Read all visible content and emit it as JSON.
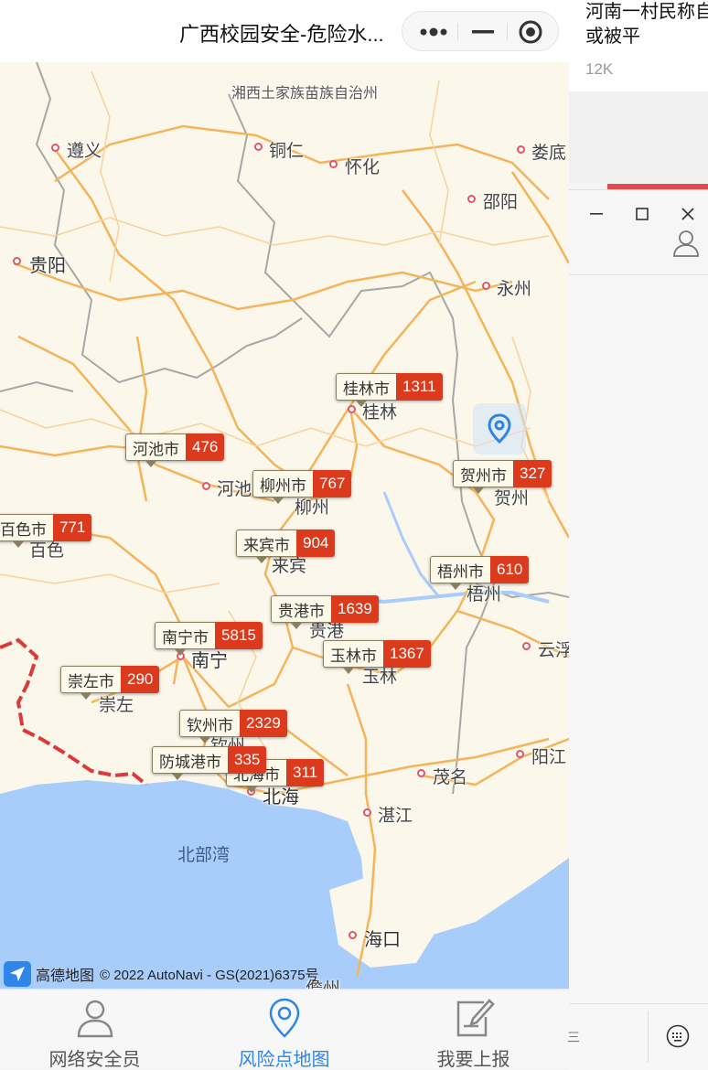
{
  "app": {
    "title": "广西校园安全-危险水...",
    "capsule": {
      "more_icon": "more-dots-icon",
      "minimize_icon": "minimize-icon",
      "close_icon": "record-circle-icon"
    }
  },
  "map": {
    "region_labels": [
      "湘西土家族苗族自治州"
    ],
    "places": [
      "遵义",
      "铜仁",
      "怀化",
      "娄底",
      "邵阳",
      "贵阳",
      "永州",
      "桂林",
      "河池",
      "柳州",
      "百色",
      "来宾",
      "梧州",
      "贺州",
      "贵港",
      "南宁",
      "玉林",
      "云浮",
      "崇左",
      "钦州",
      "北海",
      "茂名",
      "阳江",
      "湛江",
      "海口",
      "儋州"
    ],
    "sea_label": "北部湾",
    "markers": [
      {
        "name": "桂林市",
        "count": "1311"
      },
      {
        "name": "河池市",
        "count": "476"
      },
      {
        "name": "柳州市",
        "count": "767"
      },
      {
        "name": "贺州市",
        "count": "327"
      },
      {
        "name": "百色市",
        "count": "771"
      },
      {
        "name": "来宾市",
        "count": "904"
      },
      {
        "name": "梧州市",
        "count": "610"
      },
      {
        "name": "贵港市",
        "count": "1639"
      },
      {
        "name": "南宁市",
        "count": "5815"
      },
      {
        "name": "玉林市",
        "count": "1367"
      },
      {
        "name": "崇左市",
        "count": "290"
      },
      {
        "name": "钦州市",
        "count": "2329"
      },
      {
        "name": "防城港市",
        "count": "335"
      },
      {
        "name": "北海市",
        "count": "311"
      }
    ],
    "locate_icon": "location-pin-icon",
    "attribution": {
      "logo": "高德地图",
      "text": "© 2022 AutoNavi - GS(2021)6375号"
    },
    "colors": {
      "land": "#fbf7ea",
      "sea": "#a9cdfb",
      "road": "#f6b45a",
      "border": "#d93a3a",
      "marker_count_bg": "#dc3a1c",
      "active_tab": "#2d86e6"
    }
  },
  "tabs": [
    {
      "label": "网络安全员",
      "icon": "person-icon",
      "active": false
    },
    {
      "label": "风险点地图",
      "icon": "map-pin-icon",
      "active": true
    },
    {
      "label": "我要上报",
      "icon": "edit-report-icon",
      "active": false
    }
  ],
  "background": {
    "news_title": "河南一村民称自家地征收款或被平",
    "news_count": "12K",
    "window_buttons": [
      "minimize-icon",
      "maximize-icon",
      "close-icon"
    ],
    "user_icon": "user-icon",
    "bottom_text": "三",
    "keyboard_icon": "keyboard-icon"
  }
}
